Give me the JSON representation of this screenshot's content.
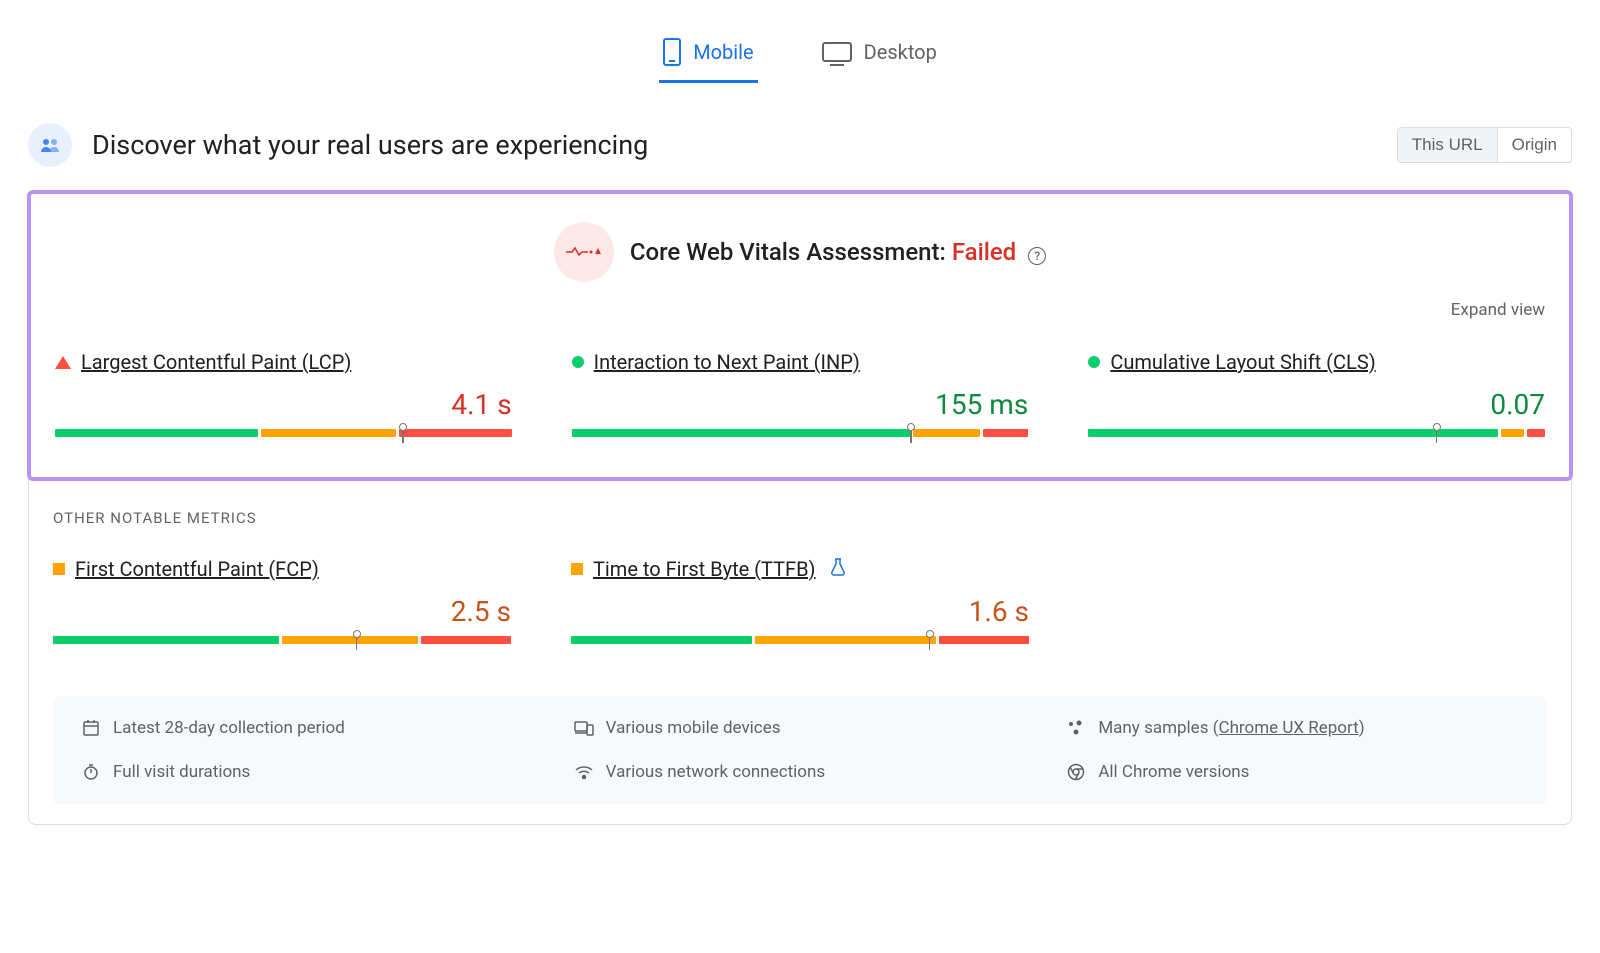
{
  "tabs": {
    "mobile": "Mobile",
    "desktop": "Desktop",
    "active": "mobile"
  },
  "header": {
    "title": "Discover what your real users are experiencing",
    "toggle": {
      "this_url": "This URL",
      "origin": "Origin",
      "active": "this_url"
    }
  },
  "cwv": {
    "title_prefix": "Core Web Vitals Assessment: ",
    "status": "Failed",
    "expand": "Expand view",
    "help": "?"
  },
  "metrics": {
    "lcp": {
      "name": "Largest Contentful Paint (LCP)",
      "value": "4.1 s",
      "status": "red",
      "bar": {
        "green": 45,
        "orange": 30,
        "red": 25,
        "marker": 75
      }
    },
    "inp": {
      "name": "Interaction to Next Paint (INP)",
      "value": "155 ms",
      "status": "green",
      "bar": {
        "green": 75,
        "orange": 15,
        "red": 10,
        "marker": 73
      }
    },
    "cls": {
      "name": "Cumulative Layout Shift (CLS)",
      "value": "0.07",
      "status": "green",
      "bar": {
        "green": 91,
        "orange": 5,
        "red": 4,
        "marker": 75
      }
    }
  },
  "other_label": "OTHER NOTABLE METRICS",
  "other": {
    "fcp": {
      "name": "First Contentful Paint (FCP)",
      "value": "2.5 s",
      "status": "orange",
      "bar": {
        "green": 50,
        "orange": 30,
        "red": 20,
        "marker": 65
      }
    },
    "ttfb": {
      "name": "Time to First Byte (TTFB)",
      "value": "1.6 s",
      "status": "orange",
      "experimental": true,
      "bar": {
        "green": 40,
        "orange": 40,
        "red": 20,
        "marker": 77
      }
    }
  },
  "info": {
    "period": "Latest 28-day collection period",
    "devices": "Various mobile devices",
    "samples_prefix": "Many samples (",
    "samples_link": "Chrome UX Report",
    "samples_suffix": ")",
    "durations": "Full visit durations",
    "network": "Various network connections",
    "chrome": "All Chrome versions"
  }
}
